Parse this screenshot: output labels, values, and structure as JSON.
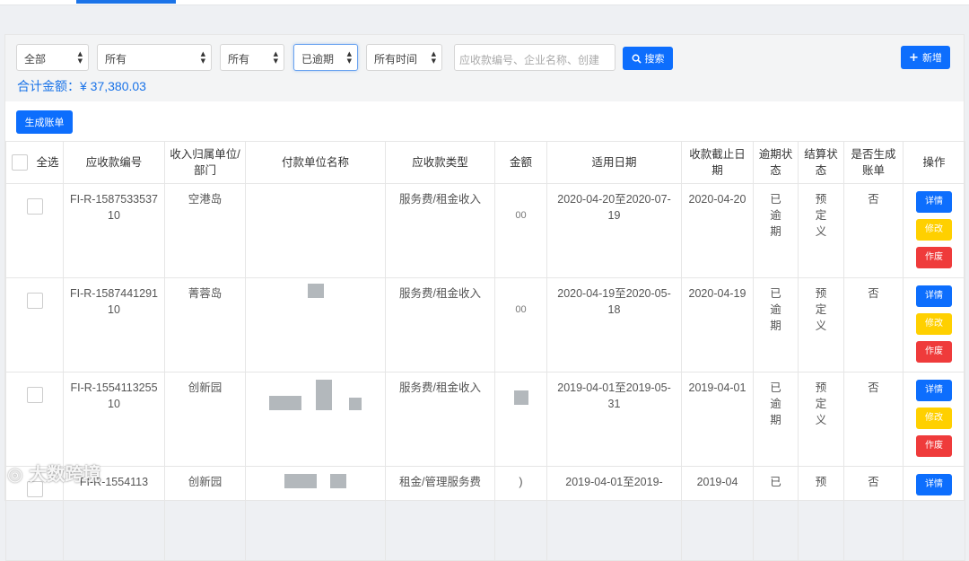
{
  "filters": {
    "f1": "全部",
    "f2": "所有",
    "f3": "所有",
    "f4": "已逾期",
    "f5": "所有时间",
    "search_placeholder": "应收款编号、企业名称、创建",
    "search_button": "搜索",
    "add_button": "新增"
  },
  "total": {
    "label": "合计金额：",
    "value": "¥ 37,380.03"
  },
  "generate_bill_button": "生成账单",
  "table": {
    "select_all": "全选",
    "headers": [
      "应收款编号",
      "收入归属单位/部门",
      "付款单位名称",
      "应收款类型",
      "金额",
      "适用日期",
      "收款截止日期",
      "逾期状态",
      "结算状态",
      "是否生成账单",
      "操作"
    ],
    "rows": [
      {
        "id": "FI-R-158753353710",
        "unit": "空港岛",
        "payer": "",
        "type": "服务费/租金收入",
        "amount": "00",
        "period": "2020-04-20至2020-07-19",
        "due": "2020-04-20",
        "overdue": "已逾期",
        "settle": "预定义",
        "bill": "否"
      },
      {
        "id": "FI-R-158744129110",
        "unit": "菁蓉岛",
        "payer": "",
        "type": "服务费/租金收入",
        "amount": "00",
        "period": "2020-04-19至2020-05-18",
        "due": "2020-04-19",
        "overdue": "已逾期",
        "settle": "预定义",
        "bill": "否"
      },
      {
        "id": "FI-R-155411325510",
        "unit": "创新园",
        "payer": "",
        "type": "服务费/租金收入",
        "amount": "",
        "period": "2019-04-01至2019-05-31",
        "due": "2019-04-01",
        "overdue": "已逾期",
        "settle": "预定义",
        "bill": "否"
      },
      {
        "id": "FI-R-1554113",
        "unit": "创新园",
        "payer": "",
        "type": "租金/管理服务费",
        "amount": ")",
        "period": "2019-04-01至2019-",
        "due": "2019-04",
        "overdue": "已",
        "settle": "预",
        "bill": "否"
      }
    ],
    "ops": {
      "detail": "详情",
      "edit": "修改",
      "void": "作废"
    }
  },
  "watermark": "大数跨境"
}
